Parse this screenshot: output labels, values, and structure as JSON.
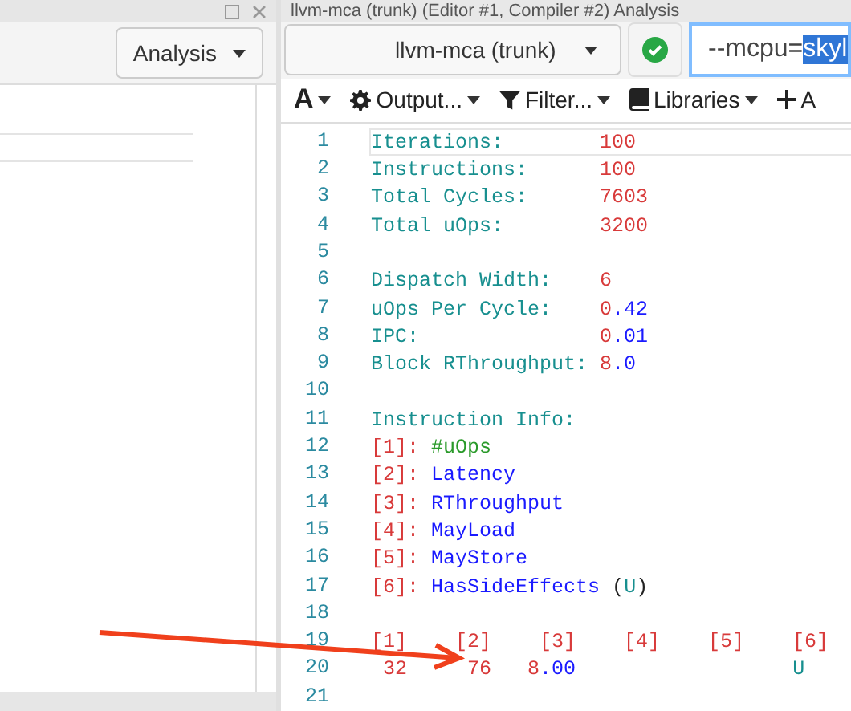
{
  "left_pane": {
    "analysis_button": "Analysis"
  },
  "right_pane": {
    "tab_title": "llvm-mca (trunk) (Editor #1, Compiler #2) Analysis",
    "compiler_select": "llvm-mca (trunk)",
    "compiler_options": {
      "prefix": "--mcpu=",
      "selected_text": "skyl"
    },
    "toolbar": [
      {
        "kind": "font",
        "label": "A",
        "dropdown": true
      },
      {
        "kind": "gear",
        "label": "Output...",
        "dropdown": true
      },
      {
        "kind": "filter",
        "label": "Filter...",
        "dropdown": true
      },
      {
        "kind": "book",
        "label": "Libraries",
        "dropdown": true
      },
      {
        "kind": "plus",
        "label": "A",
        "dropdown": false
      }
    ],
    "code_lines": [
      {
        "number": "1",
        "current": true,
        "segments": [
          {
            "kind": "key",
            "text": "Iterations:        "
          },
          {
            "kind": "num",
            "text": "100"
          }
        ]
      },
      {
        "number": "2",
        "current": false,
        "segments": [
          {
            "kind": "key",
            "text": "Instructions:      "
          },
          {
            "kind": "num",
            "text": "100"
          }
        ]
      },
      {
        "number": "3",
        "current": false,
        "segments": [
          {
            "kind": "key",
            "text": "Total Cycles:      "
          },
          {
            "kind": "num",
            "text": "7603"
          }
        ]
      },
      {
        "number": "4",
        "current": false,
        "segments": [
          {
            "kind": "key",
            "text": "Total uOps:        "
          },
          {
            "kind": "num",
            "text": "3200"
          }
        ]
      },
      {
        "number": "5",
        "current": false
      },
      {
        "number": "6",
        "current": false,
        "segments": [
          {
            "kind": "key",
            "text": "Dispatch Width:    "
          },
          {
            "kind": "num",
            "text": "6"
          }
        ]
      },
      {
        "number": "7",
        "current": false,
        "segments": [
          {
            "kind": "key",
            "text": "uOps Per Cycle:    "
          },
          {
            "kind": "num",
            "text": "0"
          },
          {
            "kind": "val",
            "text": ".42"
          }
        ]
      },
      {
        "number": "8",
        "current": false,
        "segments": [
          {
            "kind": "key",
            "text": "IPC:               "
          },
          {
            "kind": "num",
            "text": "0"
          },
          {
            "kind": "val",
            "text": ".01"
          }
        ]
      },
      {
        "number": "9",
        "current": false,
        "segments": [
          {
            "kind": "key",
            "text": "Block RThroughput: "
          },
          {
            "kind": "num",
            "text": "8"
          },
          {
            "kind": "val",
            "text": ".0"
          }
        ]
      },
      {
        "number": "10",
        "current": false
      },
      {
        "number": "11",
        "current": false,
        "segments": [
          {
            "kind": "key",
            "text": "Instruction Info:"
          }
        ]
      },
      {
        "number": "12",
        "current": false,
        "segments": [
          {
            "kind": "num",
            "text": "[1]: "
          },
          {
            "kind": "green",
            "text": "#uOps"
          }
        ]
      },
      {
        "number": "13",
        "current": false,
        "segments": [
          {
            "kind": "num",
            "text": "[2]: "
          },
          {
            "kind": "val",
            "text": "Latency"
          }
        ]
      },
      {
        "number": "14",
        "current": false,
        "segments": [
          {
            "kind": "num",
            "text": "[3]: "
          },
          {
            "kind": "val",
            "text": "RThroughput"
          }
        ]
      },
      {
        "number": "15",
        "current": false,
        "segments": [
          {
            "kind": "num",
            "text": "[4]: "
          },
          {
            "kind": "val",
            "text": "MayLoad"
          }
        ]
      },
      {
        "number": "16",
        "current": false,
        "segments": [
          {
            "kind": "num",
            "text": "[5]: "
          },
          {
            "kind": "val",
            "text": "MayStore"
          }
        ]
      },
      {
        "number": "17",
        "current": false,
        "segments": [
          {
            "kind": "num",
            "text": "[6]: "
          },
          {
            "kind": "val",
            "text": "HasSideEffects"
          },
          {
            "kind": "plain",
            "text": " ("
          },
          {
            "kind": "key",
            "text": "U"
          },
          {
            "kind": "plain",
            "text": ")"
          }
        ]
      },
      {
        "number": "18",
        "current": false
      },
      {
        "number": "19",
        "current": false,
        "segments": [
          {
            "kind": "num",
            "text": "[1]    [2]    [3]    [4]    [5]    [6]"
          }
        ]
      },
      {
        "number": "20",
        "current": false,
        "segments": [
          {
            "kind": "num",
            "text": " 32     76   8"
          },
          {
            "kind": "val",
            "text": ".00"
          },
          {
            "kind": "key",
            "text": "                  U"
          }
        ]
      },
      {
        "number": "21",
        "current": false
      }
    ]
  }
}
